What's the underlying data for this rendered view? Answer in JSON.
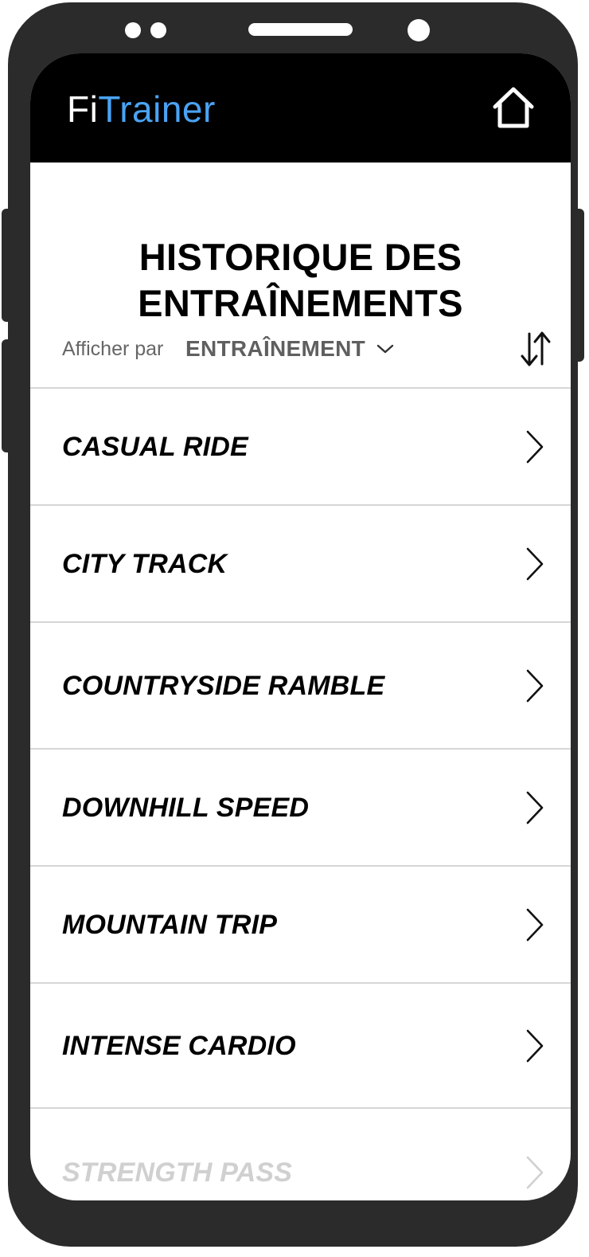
{
  "app": {
    "logo_part1": "Fi",
    "logo_part2": "Trainer",
    "accent_color": "#4aa3f5",
    "header_color": "#000000",
    "home_icon": "home-icon"
  },
  "page": {
    "title": "HISTORIQUE DES ENTRAÎNEMENTS"
  },
  "filter": {
    "label": "Afficher par",
    "selected_value": "ENTRAÎNEMENT",
    "dropdown_icon": "chevron-down-icon",
    "sort_icon": "sort-arrows-icon"
  },
  "workouts": [
    {
      "label": "CASUAL RIDE"
    },
    {
      "label": "CITY TRACK"
    },
    {
      "label": "COUNTRYSIDE RAMBLE"
    },
    {
      "label": "DOWNHILL SPEED"
    },
    {
      "label": "MOUNTAIN TRIP"
    },
    {
      "label": "INTENSE CARDIO"
    },
    {
      "label": "STRENGTH PASS"
    }
  ]
}
